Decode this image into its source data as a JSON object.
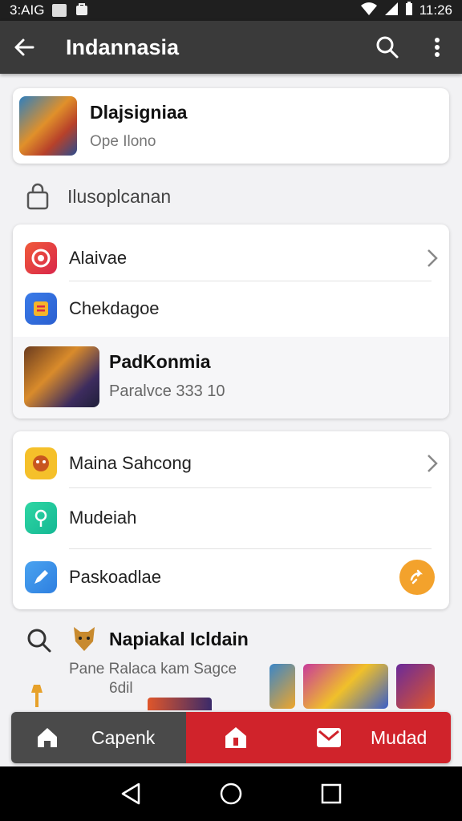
{
  "status_bar": {
    "left_text": "3:AIG",
    "time": "11:26"
  },
  "app_bar": {
    "title": "Indannasia"
  },
  "top_card": {
    "title": "Dlajsigniaa",
    "subtitle": "Ope Ilono"
  },
  "section": {
    "label": "Ilusoplcanan"
  },
  "list1": {
    "items": [
      {
        "label": "Alaivae"
      },
      {
        "label": "Chekdagoe"
      }
    ],
    "game": {
      "title": "PadKonmia",
      "subtitle": "Paralvce 333 10"
    }
  },
  "list2": {
    "items": [
      {
        "label": "Maina Sahcong"
      },
      {
        "label": "Mudeiah"
      },
      {
        "label": "Paskoadlae"
      }
    ]
  },
  "bottom_section": {
    "title": "Napiakal Icldain",
    "subtitle": "Pane Ralaca kam Sagce",
    "subtitle2": "6dil"
  },
  "tab_bar": {
    "left_label": "Capenk",
    "right_label": "Mudad"
  },
  "colors": {
    "app_bar": "#3a3a3a",
    "accent_red": "#d0232b",
    "orange": "#f3a22c"
  }
}
